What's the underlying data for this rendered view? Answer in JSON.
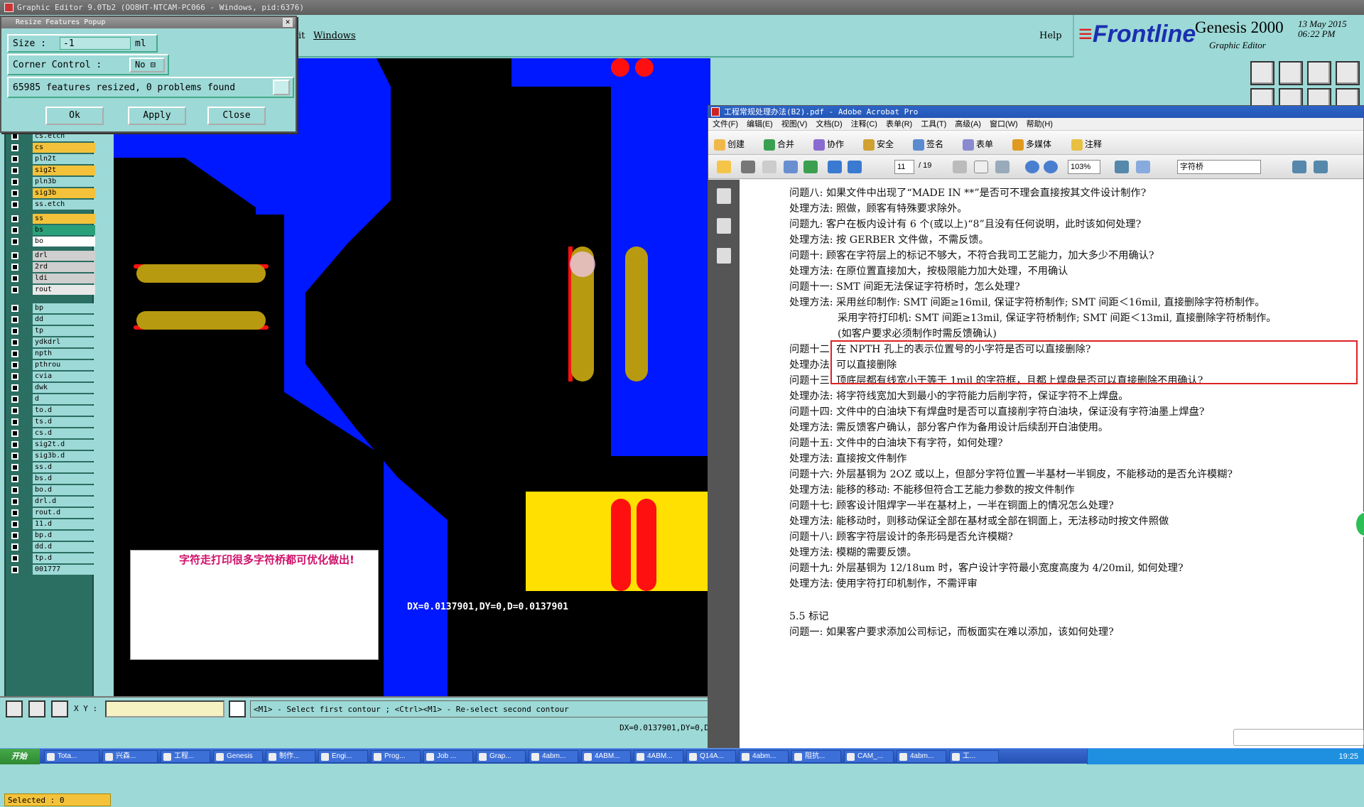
{
  "ge_window": {
    "title": "Graphic Editor 9.0Tb2  (OO8HT-NTCAM-PC066 - Windows, pid:6376)",
    "menu": {
      "edit_partial": "it",
      "windows": "Windows",
      "help": "Help"
    },
    "logo": {
      "brand": "Frontline",
      "product": "Genesis 2000",
      "subtitle": "Graphic Editor",
      "date": "13 May 2015",
      "time": "06:22 PM"
    }
  },
  "popup": {
    "title": "Resize Features Popup",
    "size_label": "Size :",
    "size_value": "-1",
    "size_unit": "ml",
    "corner_label": "Corner Control :",
    "corner_value": "No",
    "status": "65985 features resized, 0 problems found",
    "ok": "Ok",
    "apply": "Apply",
    "close": "Close"
  },
  "layers": [
    "cs.etch",
    "cs",
    "pln2t",
    "sig2t",
    "pln3b",
    "sig3b",
    "ss.etch",
    "ss",
    "bs",
    "bo",
    "drl",
    "2rd",
    "ldi",
    "rout",
    "bp",
    "dd",
    "tp",
    "ydkdrl",
    "npth",
    "pthrou",
    "cvia",
    "dwk",
    "d",
    "to.d",
    "ts.d",
    "cs.d",
    "sig2t.d",
    "sig3b.d",
    "ss.d",
    "bs.d",
    "bo.d",
    "drl.d",
    "rout.d",
    "11.d",
    "bp.d",
    "dd.d",
    "tp.d",
    "001777"
  ],
  "selected": "Selected : 0",
  "canvas": {
    "note": "字符走打印很多字符桥都可优化做出!",
    "coords": "DX=0.0137901,DY=0,D=0.0137901"
  },
  "bottom": {
    "xy_label": "X Y :",
    "prompt": "<M1> - Select first contour ; <Ctrl><M1> - Re-select second contour",
    "coords": "DX=0.0137901,DY=0,D"
  },
  "acrobat": {
    "title": "工程常规处理办法(B2).pdf - Adobe Acrobat Pro",
    "menu": [
      "文件(F)",
      "编辑(E)",
      "视图(V)",
      "文档(D)",
      "注释(C)",
      "表单(R)",
      "工具(T)",
      "高级(A)",
      "窗口(W)",
      "帮助(H)"
    ],
    "toolbar": [
      "创建",
      "合并",
      "协作",
      "安全",
      "签名",
      "表单",
      "多媒体",
      "注释"
    ],
    "page": "11",
    "page_total": "/ 19",
    "zoom": "103%",
    "search": "字符桥",
    "lines": [
      "问题八: 如果文件中出现了“MADE IN **”是否可不理会直接按其文件设计制作?",
      "处理方法: 照做，顾客有特殊要求除外。",
      "问题九: 客户在板内设计有 6 个(或以上)“8”且没有任何说明，此时该如何处理?",
      "处理方法: 按 GERBER 文件做，不需反馈。",
      "问题十: 顾客在字符层上的标记不够大，不符合我司工艺能力，加大多少不用确认?",
      "处理方法: 在原位置直接加大，按极限能力加大处理，不用确认",
      "问题十一: SMT 间距无法保证字符桥时，怎么处理?",
      "处理方法: 采用丝印制作: SMT 间距≥16mil, 保证字符桥制作; SMT 间距＜16mil, 直接删除字符桥制作。",
      "采用字符打印机: SMT 间距≥13mil, 保证字符桥制作; SMT 间距＜13mil, 直接删除字符桥制作。",
      "(如客户要求必须制作时需反馈确认)",
      "问题十二: 在 NPTH 孔上的表示位置号的小字符是否可以直接删除?",
      "处理办法: 可以直接删除",
      "问题十三: 顶底层都有线宽小于等于 1mil 的字符框，且都上焊盘是否可以直接删除不用确认?",
      "处理办法: 将字符线宽加大到最小的字符能力后削字符，保证字符不上焊盘。",
      "问题十四: 文件中的白油块下有焊盘时是否可以直接削字符白油块，保证没有字符油墨上焊盘?",
      "处理方法: 需反馈客户确认，部分客户作为备用设计后续刮开白油使用。",
      "问题十五: 文件中的白油块下有字符，如何处理?",
      "处理方法: 直接按文件制作",
      "问题十六: 外层基铜为 2OZ 或以上，但部分字符位置一半基材一半铜皮，不能移动的是否允许模糊?",
      "处理方法: 能移的移动: 不能移但符合工艺能力参数的按文件制作",
      "问题十七: 顾客设计阻焊字一半在基材上，一半在铜面上的情况怎么处理?",
      "处理方法: 能移动时，则移动保证全部在基材或全部在铜面上，无法移动时按文件照做",
      "问题十八: 顾客字符层设计的条形码是否允许模糊?",
      "处理方法: 模糊的需要反馈。",
      "问题十九: 外层基铜为 12/18um 时，客户设计字符最小宽度高度为 4/20mil, 如何处理?",
      "处理方法: 使用字符打印机制作，不需评审",
      "5.5 标记",
      "问题一: 如果客户要求添加公司标记，而板面实在难以添加，该如何处理?"
    ]
  },
  "taskbar": {
    "start": "开始",
    "tasks": [
      "Tota...",
      "兴森...",
      "工程...",
      "Genesis",
      "制作...",
      "Engi...",
      "Prog...",
      "Job ...",
      "Grap...",
      "4abm...",
      "4ABM...",
      "4ABM...",
      "Q14A...",
      "4abm...",
      "阻抗...",
      "CAM_...",
      "4abm...",
      "工..."
    ],
    "clock": "19:25"
  },
  "colors": {
    "accent": "#9dd9d6",
    "canvas_blue": "#0018ff",
    "silk_yellow": "#ffe000",
    "mustard": "#b89a10",
    "red": "#ff1010"
  }
}
